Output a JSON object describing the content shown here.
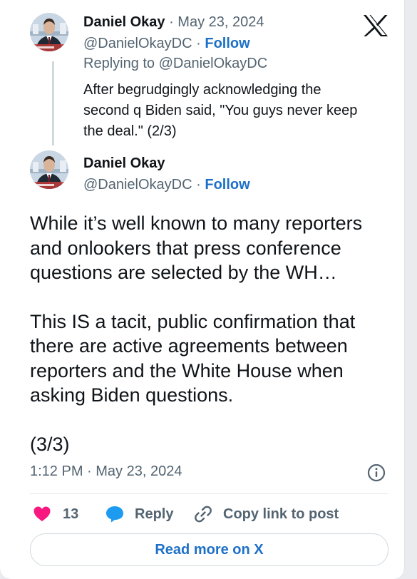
{
  "quoted_reply": {
    "author_name": "Daniel Okay",
    "date": "May 23, 2024",
    "handle": "@DanielOkayDC",
    "follow_label": "Follow",
    "replying_to": "Replying to @DanielOkayDC",
    "text_lines": [
      "After begrudgingly acknowledging the",
      "second q Biden said, \"You guys never keep",
      "the deal.\" (2/3)"
    ]
  },
  "main_post": {
    "author_name": "Daniel Okay",
    "handle": "@DanielOkayDC",
    "follow_label": "Follow",
    "paragraph_1_lines": [
      "While it’s well known to many reporters",
      "and onlookers that press conference",
      "questions are selected by the WH…"
    ],
    "paragraph_2_lines": [
      "This IS a tacit, public confirmation that",
      "there are active agreements between",
      "reporters and the White House when",
      "asking Biden questions."
    ],
    "paragraph_3": "(3/3)",
    "timestamp": "1:12 PM · May 23, 2024"
  },
  "actions": {
    "like_count": "13",
    "reply_label": "Reply",
    "copy_link_label": "Copy link to post"
  },
  "read_more_label": "Read more on X",
  "icons": {
    "logo": "x-logo-icon",
    "info": "info-icon",
    "like": "heart-icon",
    "reply": "speech-bubble-icon",
    "copy": "link-icon"
  },
  "colors": {
    "accent": "#1d70c7",
    "heart": "#f91880",
    "reply_bubble": "#1d9bf0",
    "muted_text": "#536471",
    "text": "#0f1419"
  }
}
